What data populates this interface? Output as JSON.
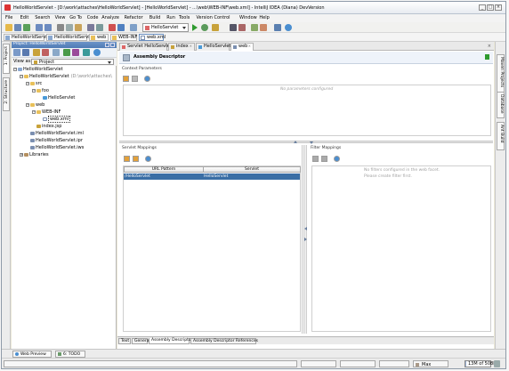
{
  "window": {
    "title": "HelloWorldServlet - [D:\\work\\attaches\\HelloWorldServlet] - [HelloWorldServlet] - ...\\web\\WEB-INF\\web.xml] - IntelliJ IDEA (Diana) DevVersion",
    "buttons": [
      "_",
      "□",
      "×"
    ]
  },
  "menu": [
    "File",
    "Edit",
    "Search",
    "View",
    "Go To",
    "Code",
    "Analyze",
    "Refactor",
    "Build",
    "Run",
    "Tools",
    "Version Control",
    "Window",
    "Help"
  ],
  "toolbar": {
    "run_config": "HelloServlet",
    "icons": [
      "open-icon",
      "save-icon",
      "refresh-icon",
      "undo-icon",
      "redo-icon",
      "cut-icon",
      "copy-icon",
      "paste-icon",
      "find-icon",
      "replace-icon",
      "back-icon",
      "forward-icon",
      "build-icon",
      "run-icon",
      "debug-icon",
      "settings-icon",
      "structure-icon",
      "help-icon"
    ]
  },
  "breadcrumbs": [
    "HelloWorldServlet",
    "HelloWorldServlet",
    "web",
    "WEB-INF",
    "web.xml"
  ],
  "left_strip_tabs": [
    "1: Project",
    "2: Structure"
  ],
  "project": {
    "header": "Project: HelloWorldServlet",
    "view_label": "View as:",
    "view_value": "Project",
    "tree": [
      {
        "label": "HelloWorldServlet",
        "depth": 0,
        "icon": "module",
        "expanded": true
      },
      {
        "label": "HelloWorldServlet",
        "suffix": "(D:\\work\\attaches\\",
        "depth": 1,
        "icon": "folder",
        "expanded": true
      },
      {
        "label": "src",
        "depth": 2,
        "icon": "folder",
        "expanded": true
      },
      {
        "label": "foo",
        "depth": 3,
        "icon": "folder",
        "expanded": true
      },
      {
        "label": "HelloServlet",
        "depth": 4,
        "icon": "java"
      },
      {
        "label": "web",
        "depth": 2,
        "icon": "folder",
        "expanded": true
      },
      {
        "label": "WEB-INF",
        "depth": 3,
        "icon": "folder",
        "expanded": true
      },
      {
        "label": "web.xml",
        "depth": 4,
        "icon": "xml",
        "selected": true
      },
      {
        "label": "index.jsp",
        "depth": 3,
        "icon": "jsp"
      },
      {
        "label": "HelloWorldServlet.iml",
        "depth": 2,
        "icon": "iml"
      },
      {
        "label": "HelloWorldServlet.ipr",
        "depth": 2,
        "icon": "iml"
      },
      {
        "label": "HelloWorldServlet.iws",
        "depth": 2,
        "icon": "iml"
      },
      {
        "label": "Libraries",
        "depth": 1,
        "icon": "library",
        "expanded": false
      }
    ]
  },
  "editor": {
    "tabs": [
      {
        "label": "Servlet HelloServlet",
        "active": false
      },
      {
        "label": "index",
        "active": false
      },
      {
        "label": "HelloServlet",
        "active": false
      },
      {
        "label": "web",
        "active": true
      }
    ],
    "header_title": "Assembly Descriptor",
    "context_params": {
      "title": "Context Parameters",
      "empty": "No parameters configured"
    },
    "servlet_mappings": {
      "title": "Servlet Mappings",
      "columns": [
        "URL Pattern",
        "Servlet"
      ],
      "rows": [
        [
          "/HelloServlet",
          "HelloServlet"
        ]
      ]
    },
    "filter_mappings": {
      "title": "Filter Mappings",
      "empty_line1": "No filters configured in the web facet.",
      "empty_line2": "Please create filter first."
    },
    "bottom_tabs": [
      {
        "label": "Text",
        "active": false
      },
      {
        "label": "General",
        "active": false
      },
      {
        "label": "Assembly Descriptor",
        "active": true
      },
      {
        "label": "Assembly Descriptor References",
        "active": false
      }
    ]
  },
  "right_strip_tabs": [
    "Maven Projects",
    "Database",
    "Ant Build"
  ],
  "bottom_tool_tabs": [
    "Web Preview",
    "6: TODO"
  ],
  "status": {
    "insert_mode": "Max",
    "memory": "13M of 508M",
    "memory_fraction": 0.03
  },
  "colors": {
    "selection": "#3a6ea5",
    "accent": "#4f7ab5",
    "green_marker": "#2e9a2e"
  }
}
